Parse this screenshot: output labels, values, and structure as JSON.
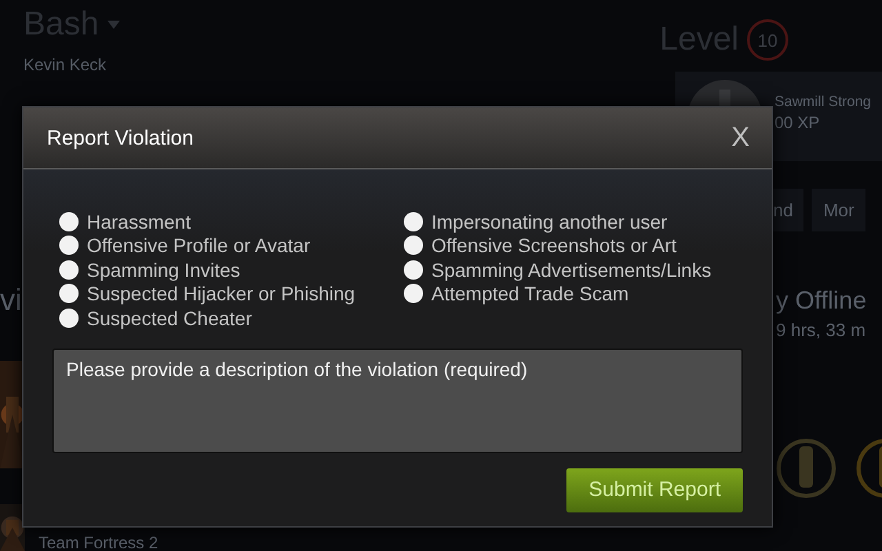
{
  "profile": {
    "name": "Bash",
    "real_name": "Kevin Keck",
    "level_label": "Level",
    "level": "10"
  },
  "badge": {
    "title": "Sawmill Strong",
    "xp": "00 XP"
  },
  "profile_buttons": [
    "nd",
    "Mor"
  ],
  "side_fragment": "vi",
  "status": {
    "title": "y Offline",
    "detail": "9 hrs, 33 m"
  },
  "recent_game": "Team Fortress 2",
  "dialog": {
    "title": "Report Violation",
    "close": "X",
    "reasons": [
      {
        "label": "Harassment",
        "selected": false
      },
      {
        "label": "Offensive Profile or Avatar",
        "selected": false
      },
      {
        "label": "Spamming Invites",
        "selected": false
      },
      {
        "label": "Suspected Hijacker or Phishing",
        "selected": false
      },
      {
        "label": "Suspected Cheater",
        "selected": false
      },
      {
        "label": "Impersonating another user",
        "selected": false
      },
      {
        "label": "Offensive Screenshots or Art",
        "selected": false
      },
      {
        "label": "Spamming Advertisements/Links",
        "selected": false
      },
      {
        "label": "Attempted Trade Scam",
        "selected": false
      }
    ],
    "description_placeholder": "Please provide a description of the violation (required)",
    "submit": "Submit Report"
  }
}
